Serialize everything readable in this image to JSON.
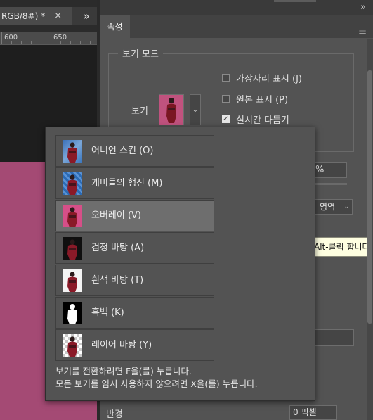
{
  "document": {
    "tab_title": "RGB/8#) *",
    "tab_close": "×",
    "overflow_icon": "»",
    "ruler_labels": [
      "600",
      "650"
    ],
    "canvas_color": "#a44a74"
  },
  "panel": {
    "tab_label": "속성",
    "collapse_icon": "»",
    "menu_icon": "≡",
    "view_mode": {
      "title": "보기 모드",
      "view_label": "보기",
      "dropdown_icon": "chevron-down-icon",
      "checkboxes": [
        {
          "label": "가장자리 표시 (J)",
          "checked": false
        },
        {
          "label": "원본 표시 (P)",
          "checked": false
        },
        {
          "label": "실시간 다듬기",
          "checked": true
        }
      ]
    },
    "opacity_value": "%",
    "area_select": "영역",
    "tooltip": "Alt-클릭 합니다",
    "radius_label": "반경",
    "radius_value": "0 픽셀"
  },
  "popup": {
    "modes": [
      {
        "label": "어니언 스킨 (O)",
        "bg": "bg-onion",
        "selected": false
      },
      {
        "label": "개미들의 행진 (M)",
        "bg": "bg-march",
        "selected": false
      },
      {
        "label": "오버레이 (V)",
        "bg": "bg-overlay",
        "selected": true
      },
      {
        "label": "검정 바탕 (A)",
        "bg": "bg-black",
        "selected": false
      },
      {
        "label": "흰색 바탕 (T)",
        "bg": "bg-white",
        "selected": false
      },
      {
        "label": "흑백 (K)",
        "bg": "bg-bw",
        "selected": false
      },
      {
        "label": "레이어 바탕 (Y)",
        "bg": "bg-layer",
        "selected": false
      }
    ],
    "hint_line1": "보기를 전환하려면 F을(를) 누릅니다.",
    "hint_line2": "모든 보기를 임시 사용하지 않으려면 X을(를) 누릅니다."
  },
  "colors": {
    "panel_bg": "#535353",
    "selected_row": "#6e6e6e",
    "tooltip_bg": "#ffffe1"
  }
}
